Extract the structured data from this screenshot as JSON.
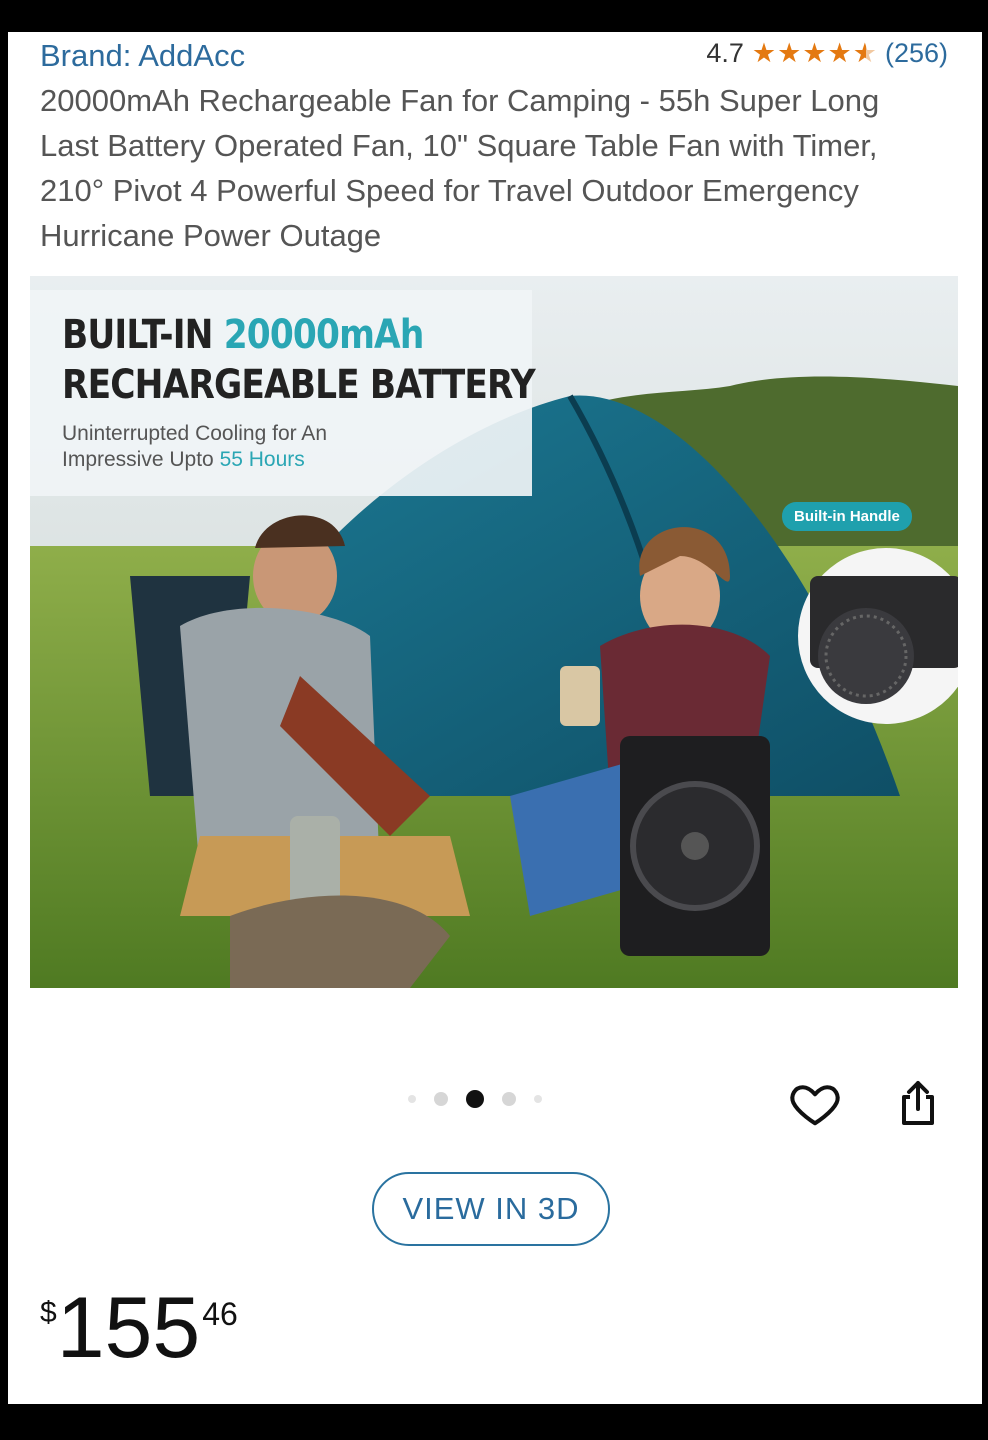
{
  "brand": {
    "label": "Brand: AddAcc"
  },
  "rating": {
    "value": "4.7",
    "stars": 4.5,
    "count": "(256)"
  },
  "product": {
    "title": "20000mAh Rechargeable Fan for Camping - 55h Super Long Last Battery Operated Fan, 10\" Square Table Fan with Timer, 210° Pivot 4 Powerful Speed for Travel Outdoor Emergency Hurricane Power Outage"
  },
  "hero": {
    "headline_prefix": "BUILT-IN ",
    "headline_accent": "20000mAh",
    "headline_line2": "RECHARGEABLE BATTERY",
    "sub_line1": "Uninterrupted Cooling for An",
    "sub_line2_prefix": "Impressive Upto ",
    "sub_line2_accent": "55 Hours",
    "handle_badge": "Built-in Handle"
  },
  "carousel": {
    "count": 5,
    "active_index": 2
  },
  "actions": {
    "view_3d": "VIEW IN 3D",
    "wishlist_icon": "heart-icon",
    "share_icon": "share-icon"
  },
  "price": {
    "currency": "$",
    "whole": "155",
    "fraction": "46"
  },
  "colors": {
    "link": "#2d6b9d",
    "star": "#e47911",
    "accent": "#2aa6b4"
  }
}
